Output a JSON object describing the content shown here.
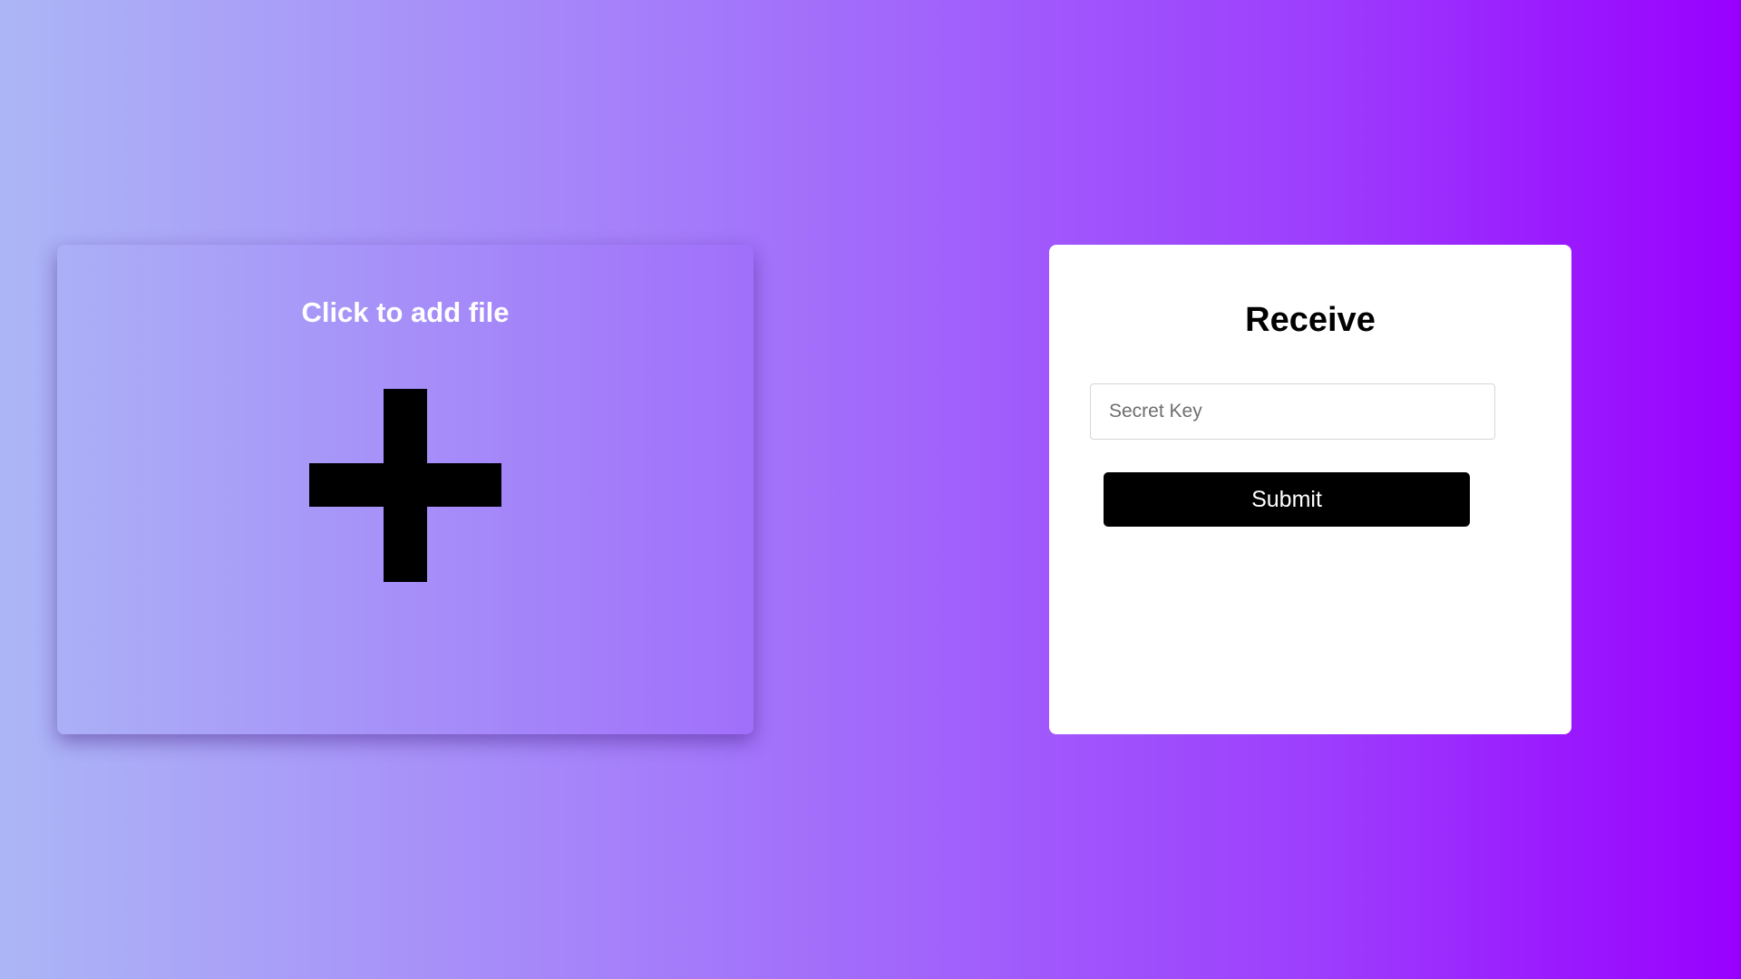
{
  "upload": {
    "title": "Click to add file",
    "icon": "plus-icon"
  },
  "receive": {
    "title": "Receive",
    "secret_key_placeholder": "Secret Key",
    "secret_key_value": "",
    "submit_label": "Submit"
  },
  "colors": {
    "background_start": "#acb6f6",
    "background_end": "#9800fe",
    "upload_card_start": "#abb0f6",
    "upload_card_end": "#a16ffb",
    "receive_card": "#ffffff",
    "submit_button": "#000000"
  }
}
